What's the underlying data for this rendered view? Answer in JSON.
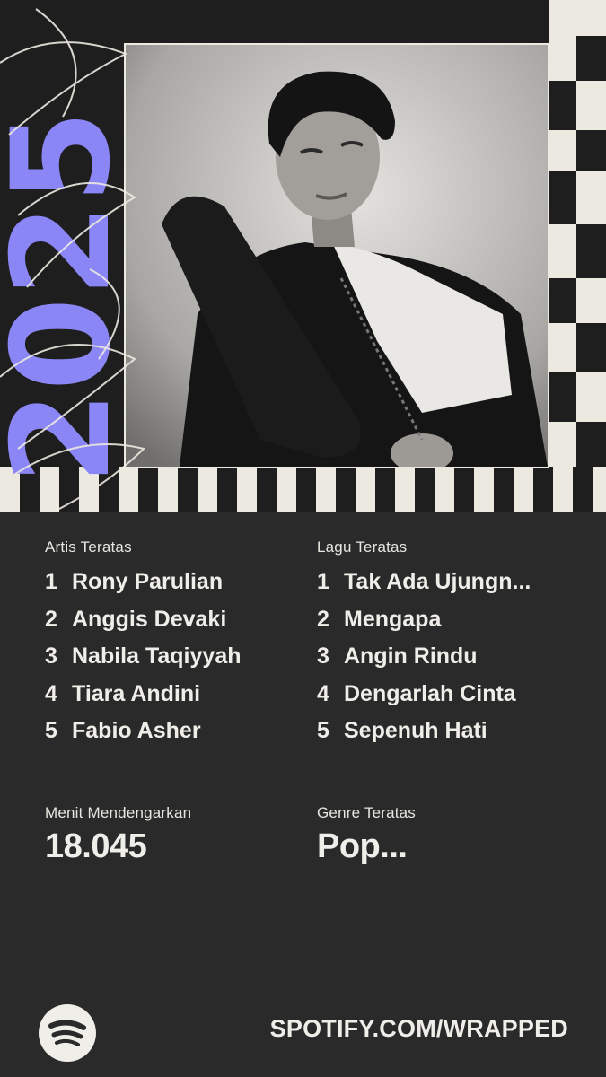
{
  "year_graphic": {
    "text": "2025",
    "color": "#8b86f5"
  },
  "photo": {
    "subject": "artist portrait"
  },
  "top_artists": {
    "label": "Artis Teratas",
    "items": [
      {
        "rank": "1",
        "name": "Rony Parulian"
      },
      {
        "rank": "2",
        "name": "Anggis Devaki"
      },
      {
        "rank": "3",
        "name": "Nabila Taqiyyah"
      },
      {
        "rank": "4",
        "name": "Tiara Andini"
      },
      {
        "rank": "5",
        "name": "Fabio Asher"
      }
    ]
  },
  "top_songs": {
    "label": "Lagu Teratas",
    "items": [
      {
        "rank": "1",
        "name": "Tak Ada Ujungn..."
      },
      {
        "rank": "2",
        "name": "Mengapa"
      },
      {
        "rank": "3",
        "name": "Angin Rindu"
      },
      {
        "rank": "4",
        "name": "Dengarlah Cinta"
      },
      {
        "rank": "5",
        "name": "Sepenuh Hati"
      }
    ]
  },
  "minutes": {
    "label": "Menit Mendengarkan",
    "value": "18.045"
  },
  "genre": {
    "label": "Genre Teratas",
    "value": "Pop..."
  },
  "footer": {
    "logo_icon": "spotify-logo-icon",
    "url": "SPOTIFY.COM/WRAPPED"
  },
  "colors": {
    "background": "#2a2a2a",
    "accent": "#8b86f5",
    "cream": "#ece9e0"
  }
}
